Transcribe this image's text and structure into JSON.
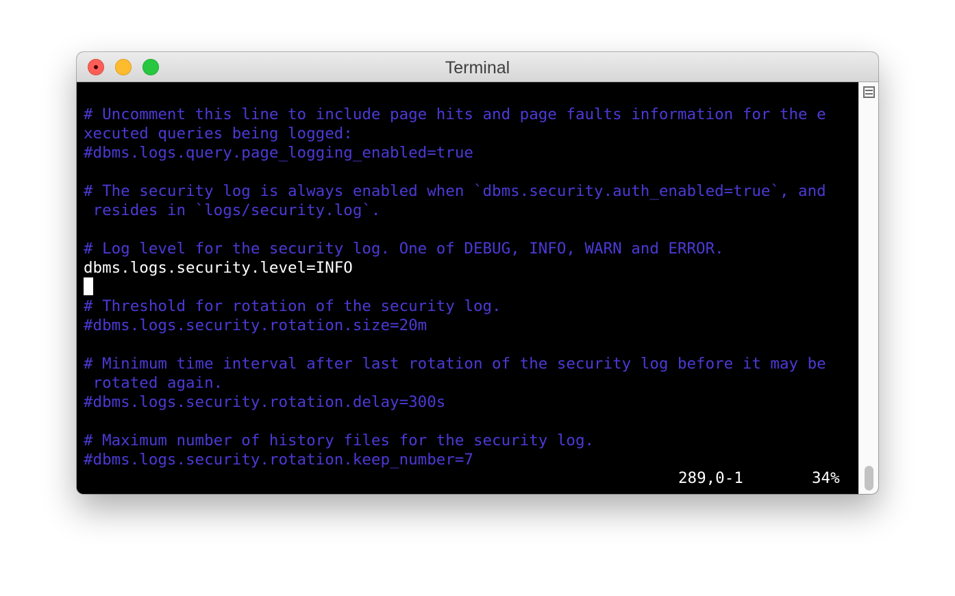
{
  "window": {
    "title": "Terminal"
  },
  "editor": {
    "lines": [
      {
        "text": "# Uncomment this line to include page hits and page faults information for the e",
        "kind": "comment"
      },
      {
        "text": "xecuted queries being logged:",
        "kind": "comment"
      },
      {
        "text": "#dbms.logs.query.page_logging_enabled=true",
        "kind": "comment"
      },
      {
        "text": "",
        "kind": "blank"
      },
      {
        "text": "# The security log is always enabled when `dbms.security.auth_enabled=true`, and",
        "kind": "comment"
      },
      {
        "text": " resides in `logs/security.log`.",
        "kind": "comment"
      },
      {
        "text": "",
        "kind": "blank"
      },
      {
        "text": "# Log level for the security log. One of DEBUG, INFO, WARN and ERROR.",
        "kind": "comment"
      },
      {
        "text": "dbms.logs.security.level=INFO",
        "kind": "setting"
      },
      {
        "text": "",
        "kind": "blank"
      },
      {
        "text": "# Threshold for rotation of the security log.",
        "kind": "comment"
      },
      {
        "text": "#dbms.logs.security.rotation.size=20m",
        "kind": "comment"
      },
      {
        "text": "",
        "kind": "blank"
      },
      {
        "text": "# Minimum time interval after last rotation of the security log before it may be",
        "kind": "comment"
      },
      {
        "text": " rotated again.",
        "kind": "comment"
      },
      {
        "text": "#dbms.logs.security.rotation.delay=300s",
        "kind": "comment"
      },
      {
        "text": "",
        "kind": "blank"
      },
      {
        "text": "# Maximum number of history files for the security log.",
        "kind": "comment"
      },
      {
        "text": "#dbms.logs.security.rotation.keep_number=7",
        "kind": "comment"
      }
    ],
    "status": {
      "position": "289,0-1",
      "percent": "34%"
    }
  },
  "colors": {
    "comment": "#4b3ad6",
    "setting": "#ffffff",
    "background": "#000000"
  },
  "icons": {
    "split": "split-pane-icon"
  }
}
